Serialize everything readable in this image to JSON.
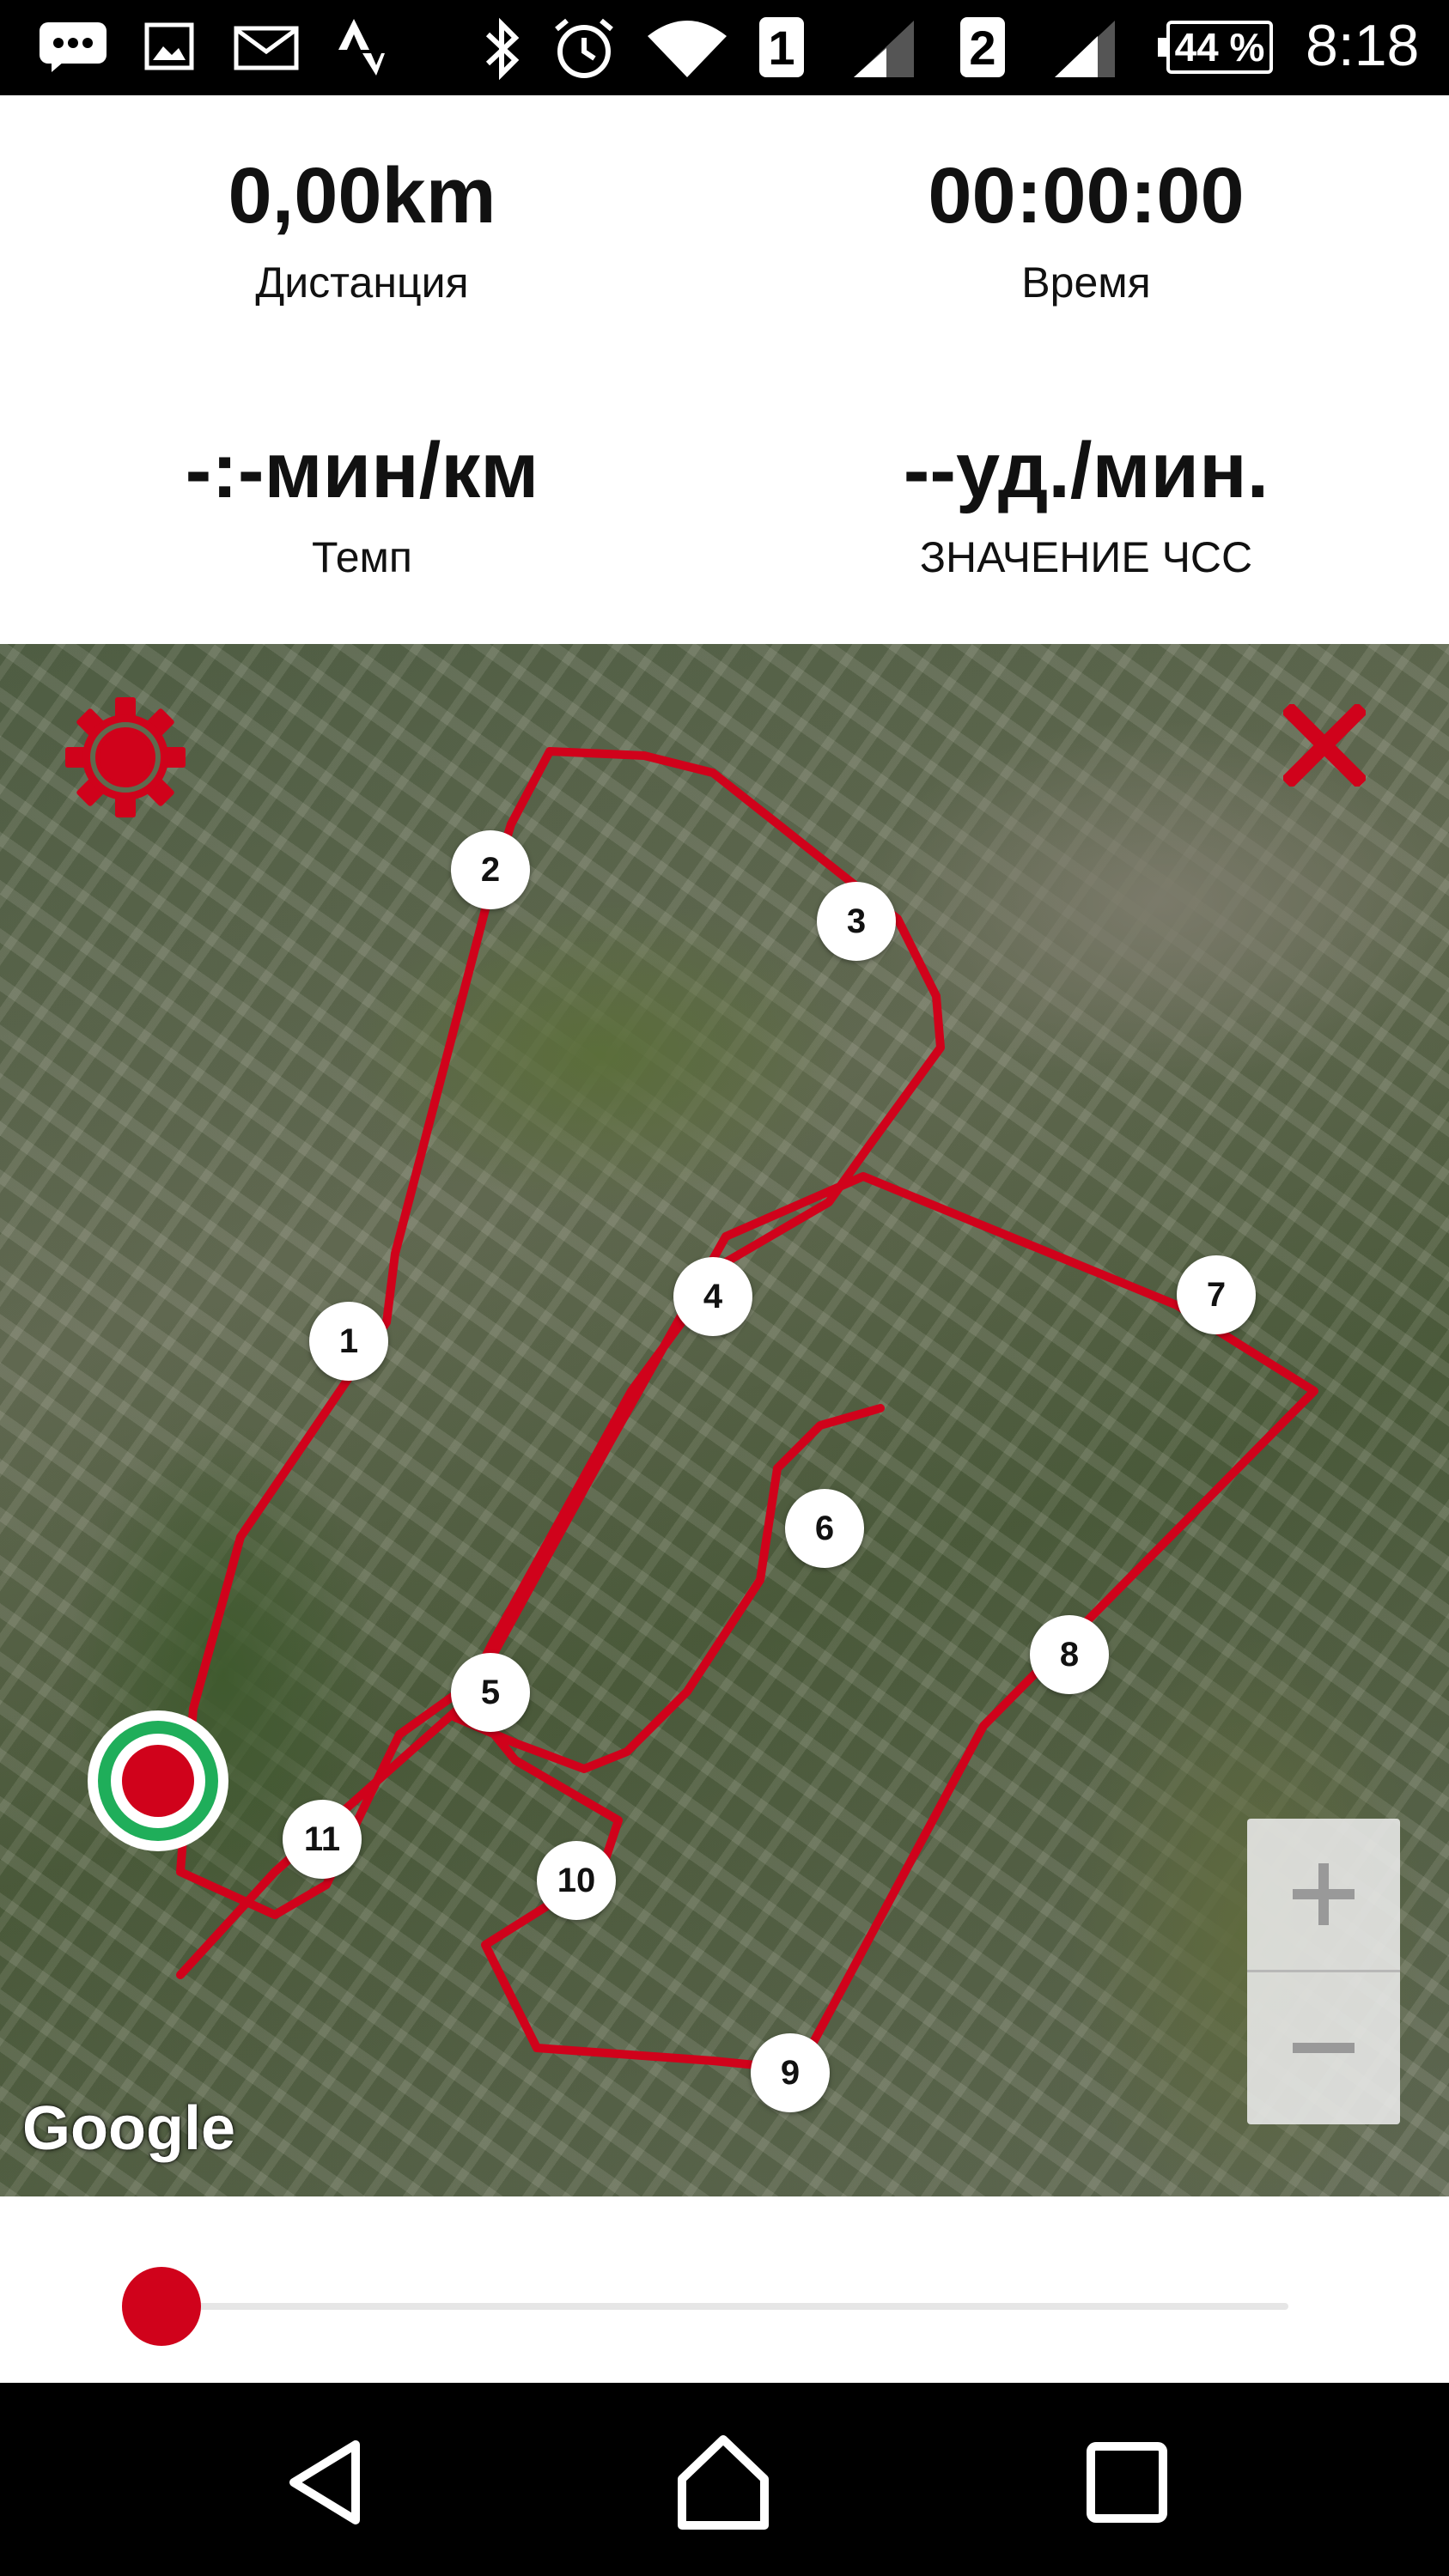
{
  "status_bar": {
    "sim1": "1",
    "sim2": "2",
    "battery": "44 %",
    "time": "8:18",
    "icons": [
      "messages-icon",
      "gallery-icon",
      "mail-icon",
      "strava-icon",
      "bluetooth-icon",
      "alarm-icon",
      "wifi-icon",
      "signal-icon",
      "signal-icon",
      "battery-icon"
    ]
  },
  "stats": {
    "distance": {
      "value": "0,00km",
      "label": "Дистанция"
    },
    "time": {
      "value": "00:00:00",
      "label": "Время"
    },
    "pace": {
      "value": "-:-мин/км",
      "label": "Темп"
    },
    "heart_rate": {
      "value": "--уд./мин.",
      "label": "ЗНАЧЕНИЕ ЧСС"
    }
  },
  "map": {
    "provider_logo": "Google",
    "route_color": "#d0021b",
    "waypoints": [
      "1",
      "2",
      "3",
      "4",
      "5",
      "6",
      "7",
      "8",
      "9",
      "10",
      "11"
    ],
    "zoom_in": "+",
    "zoom_out": "−"
  },
  "slider": {
    "value": 0
  },
  "colors": {
    "accent": "#d0021b",
    "start_ring": "#1fae5a"
  }
}
